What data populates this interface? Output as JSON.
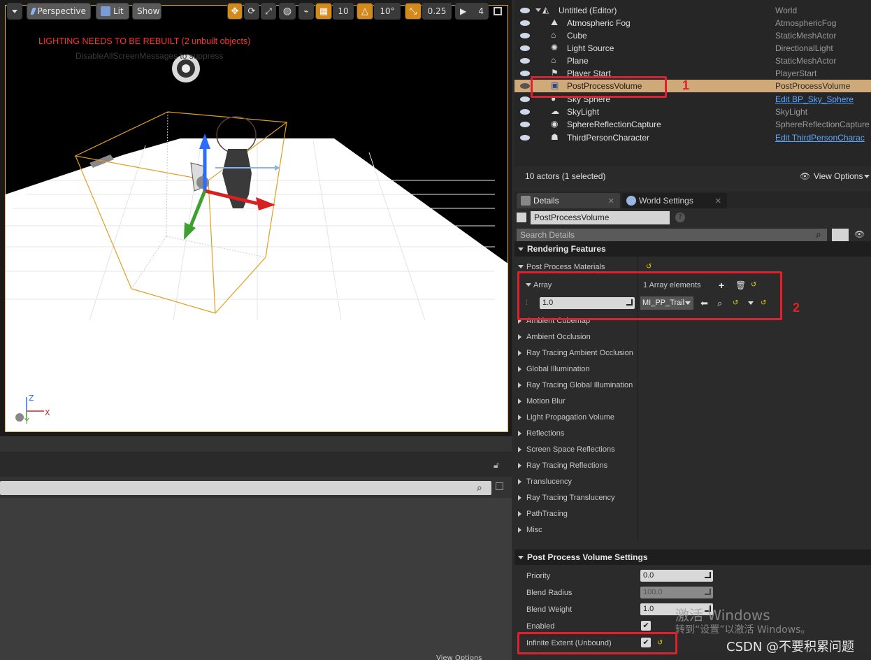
{
  "viewport": {
    "perspective_label": "Perspective",
    "lit_label": "Lit",
    "show_label": "Show",
    "grid_snap": "10",
    "rot_snap": "10°",
    "scale_snap": "0.25",
    "cam_speed": "4",
    "warning": "LIGHTING NEEDS TO BE REBUILT (2 unbuilt objects)",
    "warning_sub": "DisableAllScreenMessages to suppress",
    "axis_z": "Z",
    "axis_x": "X",
    "axis_y": "Y"
  },
  "outliner": {
    "rows": [
      {
        "name": "Untitled (Editor)",
        "type": "World"
      },
      {
        "name": "Atmospheric Fog",
        "type": "AtmosphericFog"
      },
      {
        "name": "Cube",
        "type": "StaticMeshActor"
      },
      {
        "name": "Light Source",
        "type": "DirectionalLight"
      },
      {
        "name": "Plane",
        "type": "StaticMeshActor"
      },
      {
        "name": "Player Start",
        "type": "PlayerStart"
      },
      {
        "name": "PostProcessVolume",
        "type": "PostProcessVolume"
      },
      {
        "name": "Sky Sphere",
        "type": "Edit BP_Sky_Sphere"
      },
      {
        "name": "SkyLight",
        "type": "SkyLight"
      },
      {
        "name": "SphereReflectionCapture",
        "type": "SphereReflectionCapture"
      },
      {
        "name": "ThirdPersonCharacter",
        "type": "Edit ThirdPersonCharac"
      }
    ],
    "footer_count": "10 actors (1 selected)",
    "view_options": "View Options"
  },
  "details": {
    "tab_details": "Details",
    "tab_world": "World Settings",
    "actor_name": "PostProcessVolume",
    "search_placeholder": "Search Details",
    "cat_rendering": "Rendering Features",
    "ppm_label": "Post Process Materials",
    "array_label": "Array",
    "array_elements": "1 Array elements",
    "array_weight": "1.0",
    "array_material": "MI_PP_Trail",
    "sections": [
      "Ambient Cubemap",
      "Ambient Occlusion",
      "Ray Tracing Ambient Occlusion",
      "Global Illumination",
      "Ray Tracing Global Illumination",
      "Motion Blur",
      "Light Propagation Volume",
      "Reflections",
      "Screen Space Reflections",
      "Ray Tracing Reflections",
      "Translucency",
      "Ray Tracing Translucency",
      "PathTracing",
      "Misc"
    ],
    "cat_ppv": "Post Process Volume Settings",
    "priority_label": "Priority",
    "priority_value": "0.0",
    "blend_radius_label": "Blend Radius",
    "blend_radius_value": "100.0",
    "blend_weight_label": "Blend Weight",
    "blend_weight_value": "1.0",
    "enabled_label": "Enabled",
    "infinite_label": "Infinite Extent (Unbound)",
    "view_options_bottom": "View Options"
  },
  "annotations": {
    "num1": "1",
    "num2": "2"
  },
  "watermark": {
    "line1": "激活 Windows",
    "line2": "转到“设置”以激活 Windows。",
    "csdn": "CSDN @不要积累问题"
  },
  "colors": {
    "accent_orange": "#d48a1a",
    "selection": "#cfa97a",
    "annotation_red": "#e0202a",
    "link_blue": "#5aa5ff"
  }
}
